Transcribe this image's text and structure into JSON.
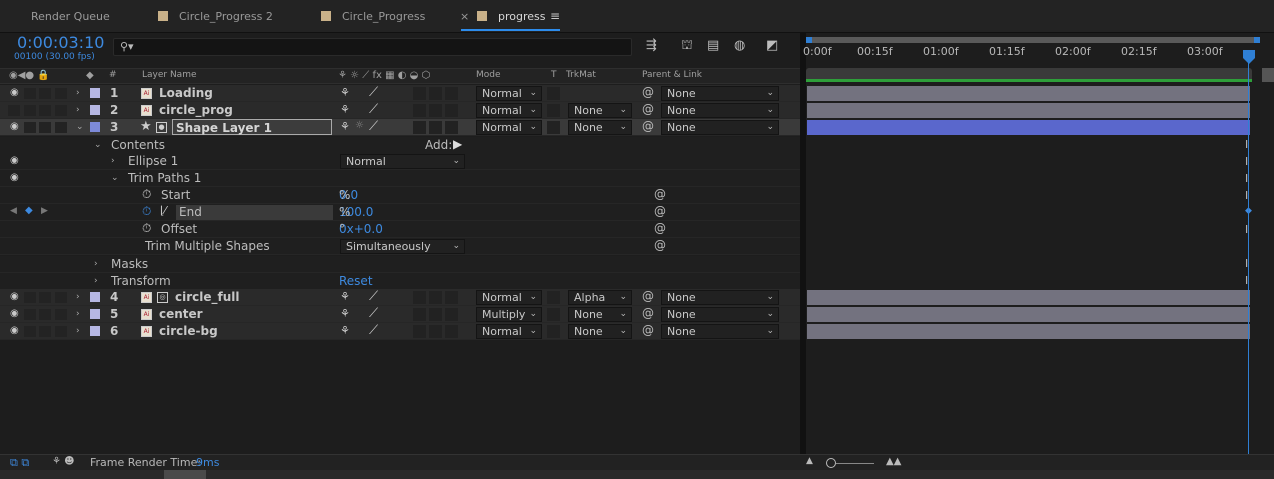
{
  "tabs": {
    "render_queue": "Render Queue",
    "circle_progress_2": "Circle_Progress 2",
    "circle_progress": "Circle_Progress",
    "active_close": "×",
    "progress": "progress",
    "menu": "≡"
  },
  "header": {
    "timecode": "0:00:03:10",
    "frame_fps": "00100 (30.00 fps)",
    "search_placeholder": ""
  },
  "columns": {
    "label_hash": "#",
    "layer_name": "Layer Name",
    "mode": "Mode",
    "t": "T",
    "trkmat": "TrkMat",
    "parent_link": "Parent & Link"
  },
  "layers_top": [
    {
      "num": "1",
      "name": "Loading",
      "mode": "Normal",
      "trkmat": "",
      "parent": "None"
    },
    {
      "num": "2",
      "name": "circle_prog",
      "mode": "Normal",
      "trkmat": "None",
      "parent": "None"
    },
    {
      "num": "3",
      "name": "Shape Layer 1",
      "mode": "Normal",
      "trkmat": "None",
      "parent": "None"
    }
  ],
  "contents": {
    "label": "Contents",
    "add_label": "Add:",
    "ellipse": "Ellipse 1",
    "ellipse_mode": "Normal",
    "trim_paths": "Trim Paths 1",
    "start_label": "Start",
    "start_value": "0.0",
    "start_unit": "%",
    "end_label": "End",
    "end_value": "100.0",
    "end_unit": "%",
    "offset_label": "Offset",
    "offset_value": "0x+0.0",
    "offset_unit": "°",
    "trim_multiple_label": "Trim Multiple Shapes",
    "trim_multiple_value": "Simultaneously",
    "masks": "Masks",
    "transform": "Transform",
    "reset": "Reset"
  },
  "layers_bottom": [
    {
      "num": "4",
      "name": "circle_full",
      "mode": "Normal",
      "trkmat": "Alpha",
      "parent": "None"
    },
    {
      "num": "5",
      "name": "center",
      "mode": "Multiply",
      "trkmat": "None",
      "parent": "None"
    },
    {
      "num": "6",
      "name": "circle-bg",
      "mode": "Normal",
      "trkmat": "None",
      "parent": "None"
    }
  ],
  "timeline": {
    "ticks": [
      "0:00f",
      "00:15f",
      "01:00f",
      "01:15f",
      "02:00f",
      "02:15f",
      "03:00f"
    ]
  },
  "footer": {
    "frame_render_label": "Frame Render Time:",
    "frame_render_value": "9ms"
  },
  "colors": {
    "accent": "#2d8ceb",
    "layer_label": "#b6b7e3",
    "selected_bar": "#5a67cc",
    "bar": "#73727f",
    "work_area": "#2e9f3a"
  }
}
